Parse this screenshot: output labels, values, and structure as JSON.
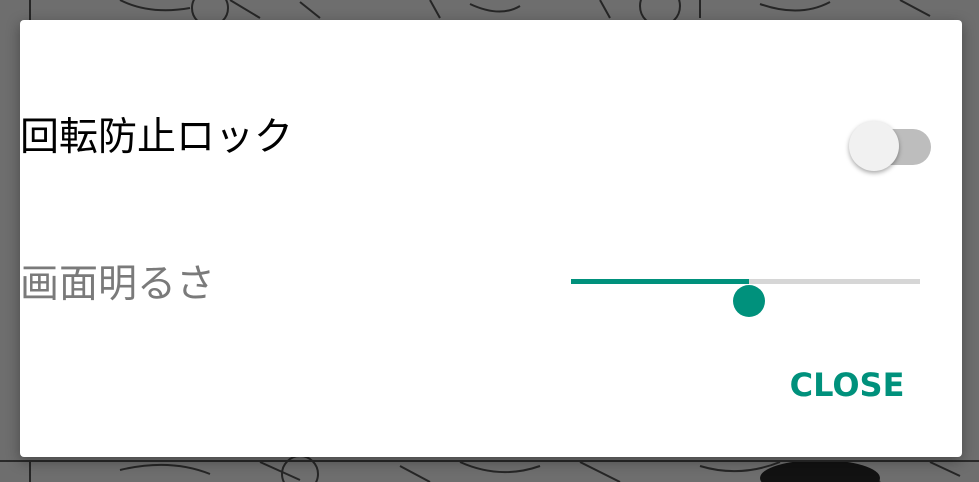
{
  "dialog": {
    "rotation_lock": {
      "label": "回転防止ロック",
      "enabled": false
    },
    "brightness": {
      "label": "画面明るさ",
      "level": 0.51
    },
    "close_label": "CLOSE"
  },
  "colors": {
    "accent": "#00917c",
    "label_enabled": "#000000",
    "label_disabled": "#7a7a7a",
    "switch_track_off": "#bdbdbd",
    "switch_thumb_off": "#f1f1f1",
    "slider_track_empty": "#d6d6d6"
  }
}
